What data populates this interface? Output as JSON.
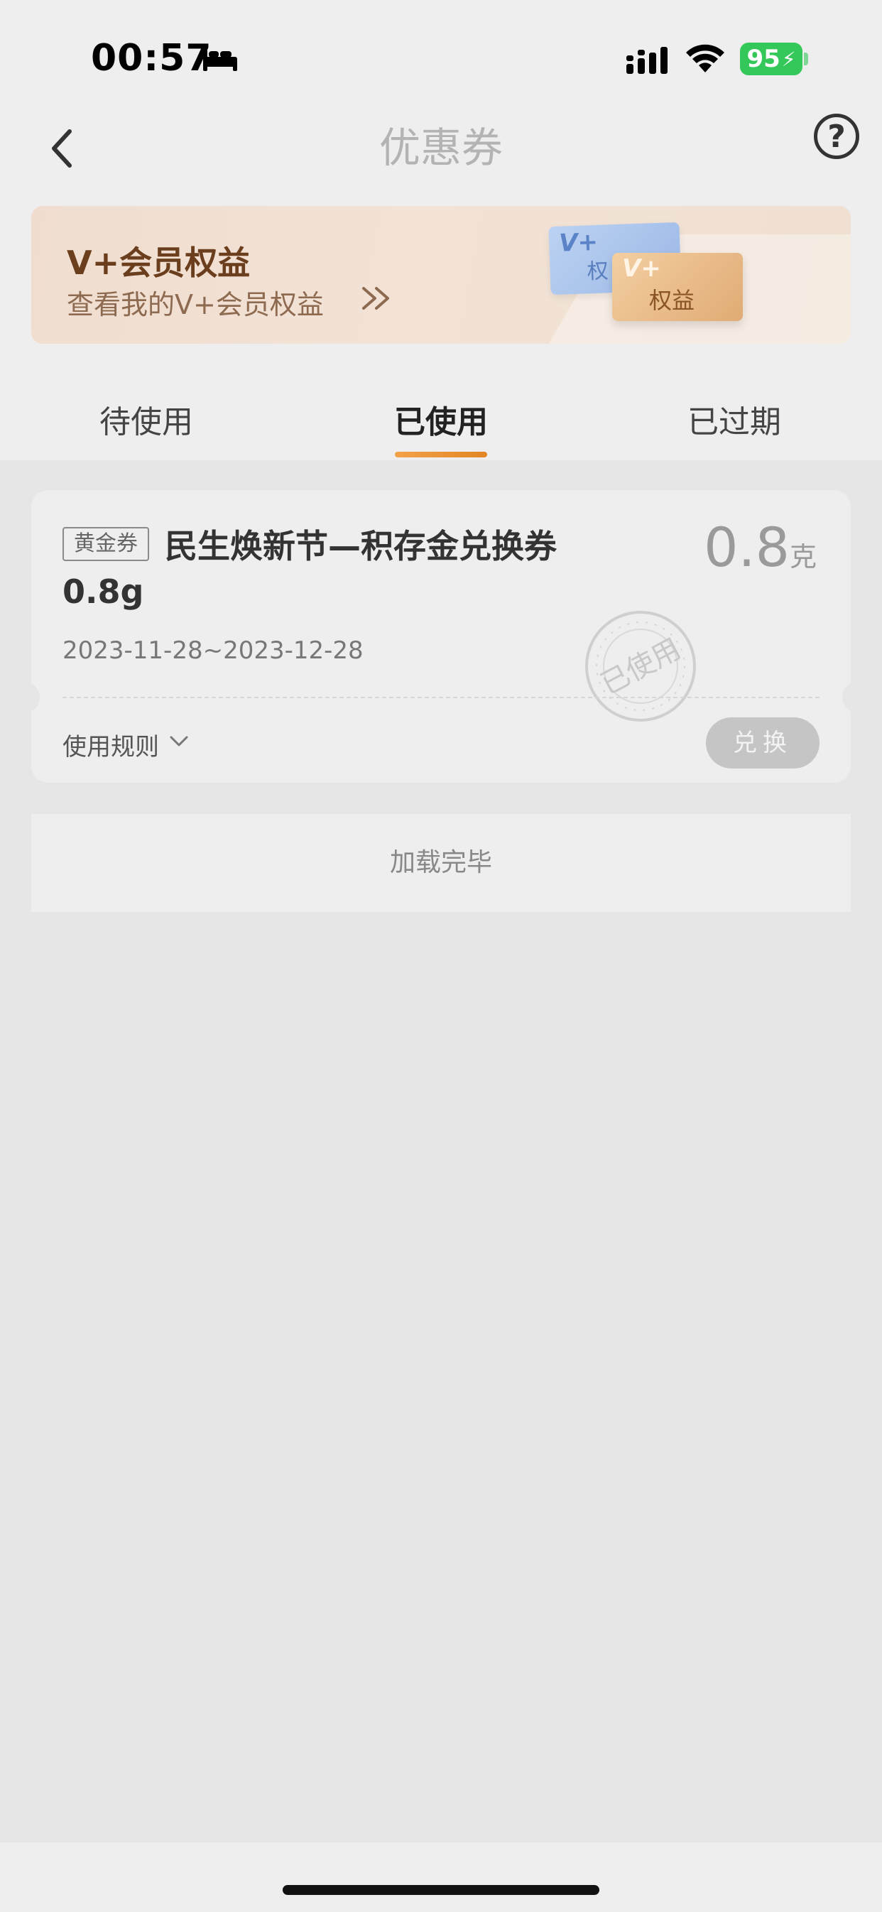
{
  "status_bar": {
    "time": "00:57",
    "battery": "95",
    "icons": [
      "bed-icon",
      "signal-icon",
      "wifi-icon",
      "battery-icon"
    ]
  },
  "nav": {
    "title": "优惠券",
    "back_icon": "chevron-left-icon",
    "help_label": "?"
  },
  "banner": {
    "title": "V+会员权益",
    "subtitle": "查看我的V+会员权益",
    "card_blue_v": "V+",
    "card_blue_text": "权",
    "card_gold_v": "V+",
    "card_gold_text": "权益"
  },
  "tabs": [
    {
      "label": "待使用",
      "active": false
    },
    {
      "label": "已使用",
      "active": true
    },
    {
      "label": "已过期",
      "active": false
    }
  ],
  "coupon": {
    "badge": "黄金券",
    "title_line1": "民生焕新节—积存金兑换券",
    "title_line2": "0.8g",
    "amount": "0.8",
    "unit": "克",
    "date_range": "2023-11-28~2023-12-28",
    "stamp_text": "已使用",
    "rules_label": "使用规则",
    "redeem_label": "兑换"
  },
  "footer": {
    "loaded_text": "加载完毕"
  },
  "colors": {
    "accent": "#e28523",
    "page_bg": "#e6e6e6",
    "card_bg": "#eeeeee",
    "battery": "#34c759"
  }
}
